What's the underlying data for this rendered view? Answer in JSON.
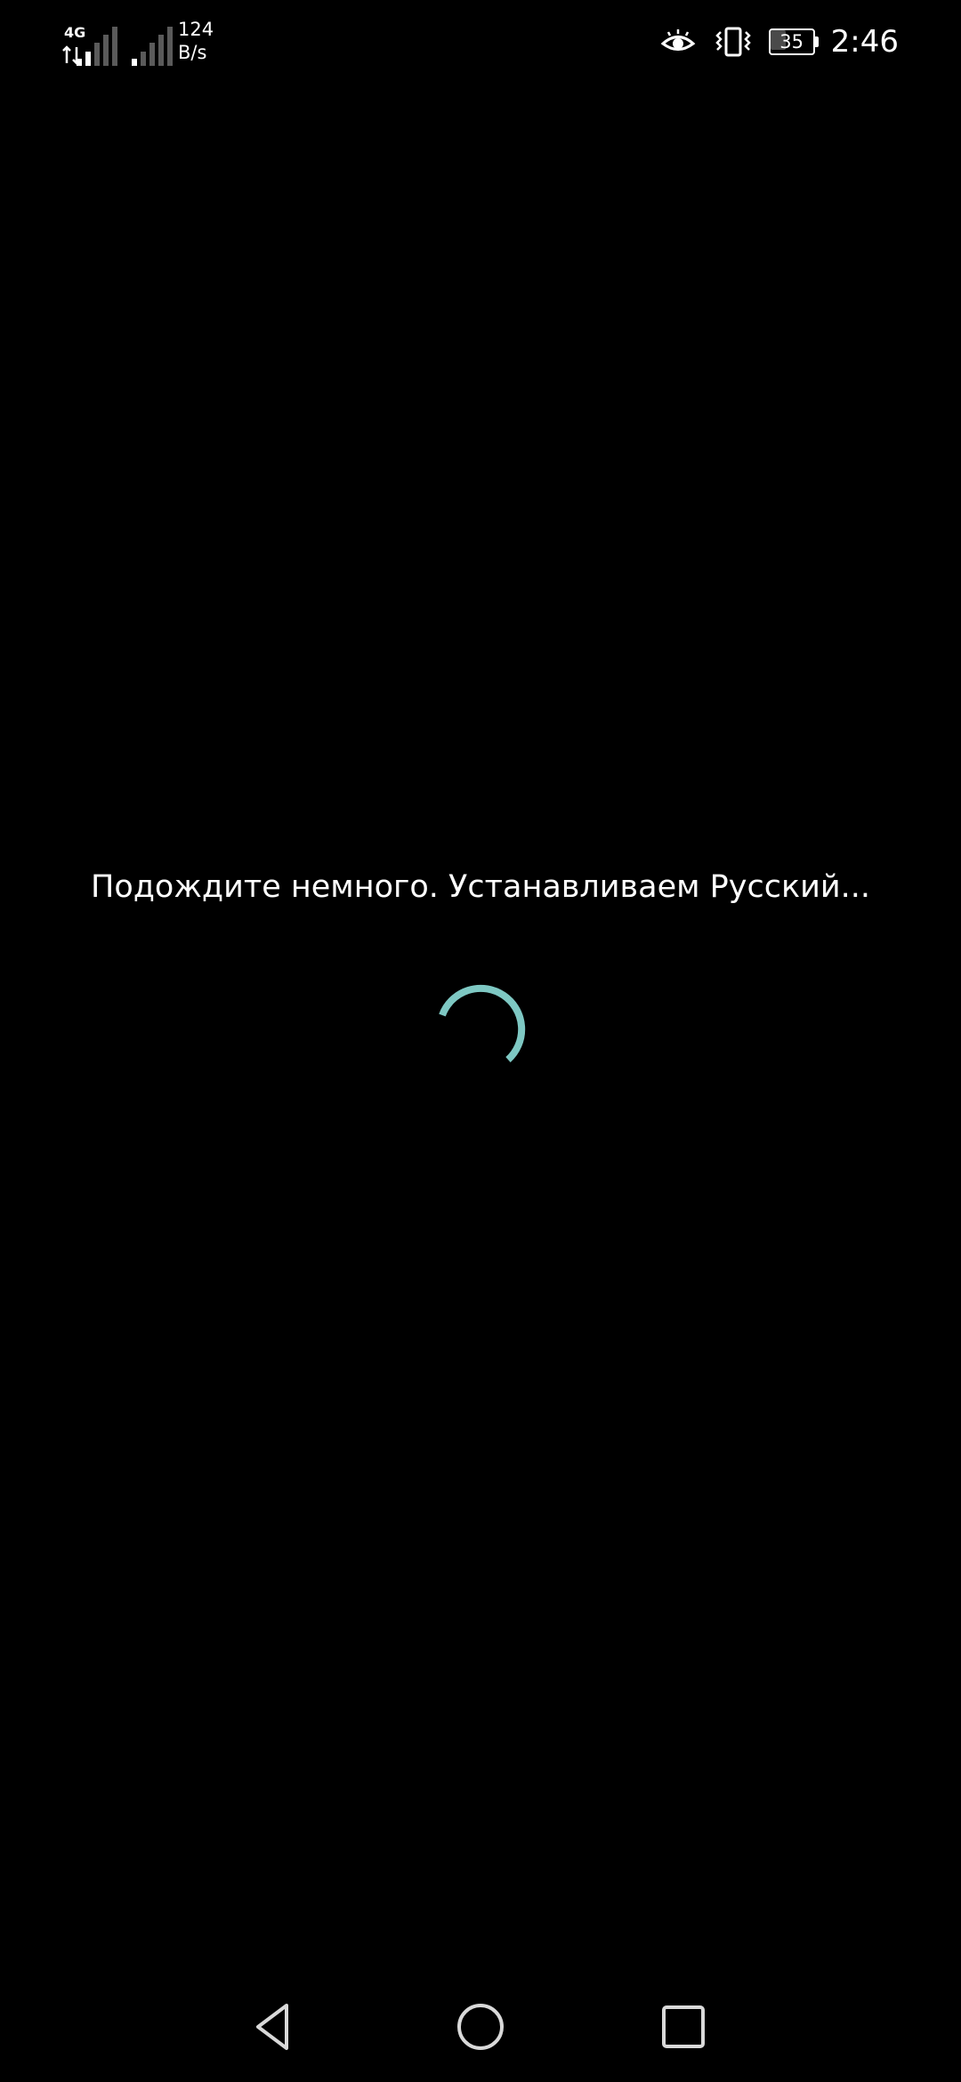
{
  "status_bar": {
    "network_type": "4G",
    "network_speed_value": "124",
    "network_speed_unit": "B/s",
    "battery_level": "35",
    "battery_fraction": 0.35,
    "time": "2:46",
    "icons": {
      "data_arrows": "data-activity-icon",
      "signal_sim1": "cellular-signal-icon",
      "signal_sim2": "cellular-signal-icon",
      "eye_comfort": "eye-icon",
      "vibrate": "vibrate-icon",
      "battery": "battery-icon"
    }
  },
  "main": {
    "message": "Подождите немного. Устанавливаем Русский...",
    "spinner_icon": "loading-spinner-icon"
  },
  "nav_bar": {
    "back_icon": "back-triangle-icon",
    "home_icon": "home-circle-icon",
    "recents_icon": "recents-square-icon"
  },
  "colors": {
    "background": "#000000",
    "text": "#ffffff",
    "spinner": "#7ec8c3",
    "nav_icons": "#d9d9d9"
  }
}
